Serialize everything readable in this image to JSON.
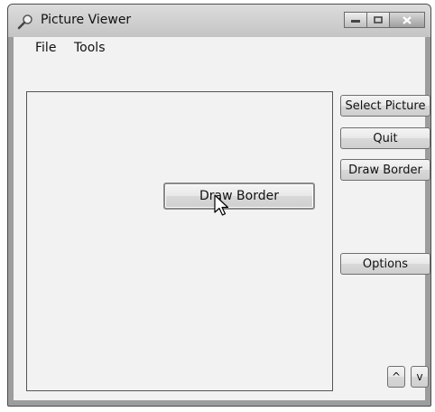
{
  "window": {
    "title": "Picture Viewer"
  },
  "menu": {
    "file": "File",
    "tools": "Tools"
  },
  "buttons": {
    "select_picture": "Select Picture",
    "quit": "Quit",
    "draw_border_side": "Draw Border",
    "draw_border_center": "Draw Border",
    "options": "Options",
    "up": "^",
    "down": "v"
  },
  "icons": {
    "title": "magnifier-icon",
    "minimize": "minimize-icon",
    "maximize": "maximize-icon",
    "close": "close-icon",
    "cursor": "cursor-arrow-icon"
  }
}
